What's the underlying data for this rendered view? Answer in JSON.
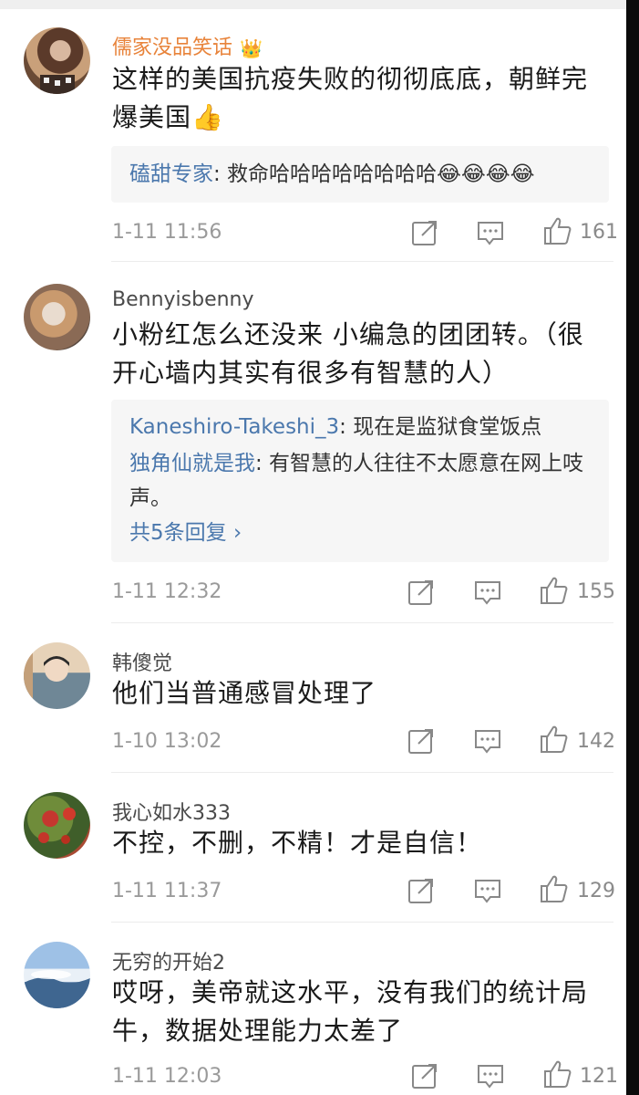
{
  "comments": [
    {
      "username": "儒家没品笑话",
      "content": "这样的美国抗疫失败的彻彻底底，朝鲜完爆美国👍",
      "reply_preview": [
        {
          "name": "磕甜专家",
          "text": ": 救命哈哈哈哈哈哈哈哈😂😂😂😂"
        }
      ],
      "time": "1-11 11:56",
      "likes": "161"
    },
    {
      "username": "Bennyisbenny",
      "content": "小粉红怎么还没来 小编急的团团转。（很开心墙内其实有很多有智慧的人）",
      "reply_preview": [
        {
          "name": "Kaneshiro-Takeshi_3",
          "text": ": 现在是监狱食堂饭点"
        },
        {
          "name": "独角仙就是我",
          "text": ": 有智慧的人往往不太愿意在网上吱声。"
        }
      ],
      "more_replies": "共5条回复 ›",
      "time": "1-11 12:32",
      "likes": "155"
    },
    {
      "username": "韩傻觉",
      "content": "他们当普通感冒处理了",
      "time": "1-10 13:02",
      "likes": "142"
    },
    {
      "username": "我心如水333",
      "content": "不控，不删，不精！才是自信！",
      "time": "1-11 11:37",
      "likes": "129"
    },
    {
      "username": "无穷的开始2",
      "content": "哎呀，美帝就这水平，没有我们的统计局牛，数据处理能力太差了",
      "time": "1-11 12:03",
      "likes": "121"
    }
  ],
  "icons": {
    "vip_badge": "crown-icon",
    "repost": "repost-icon",
    "comment": "comment-icon",
    "like": "thumbs-up-icon"
  },
  "colors": {
    "username_highlight": "#e8833a",
    "reply_link": "#4b78ad",
    "meta_text": "#9a9a9a"
  }
}
